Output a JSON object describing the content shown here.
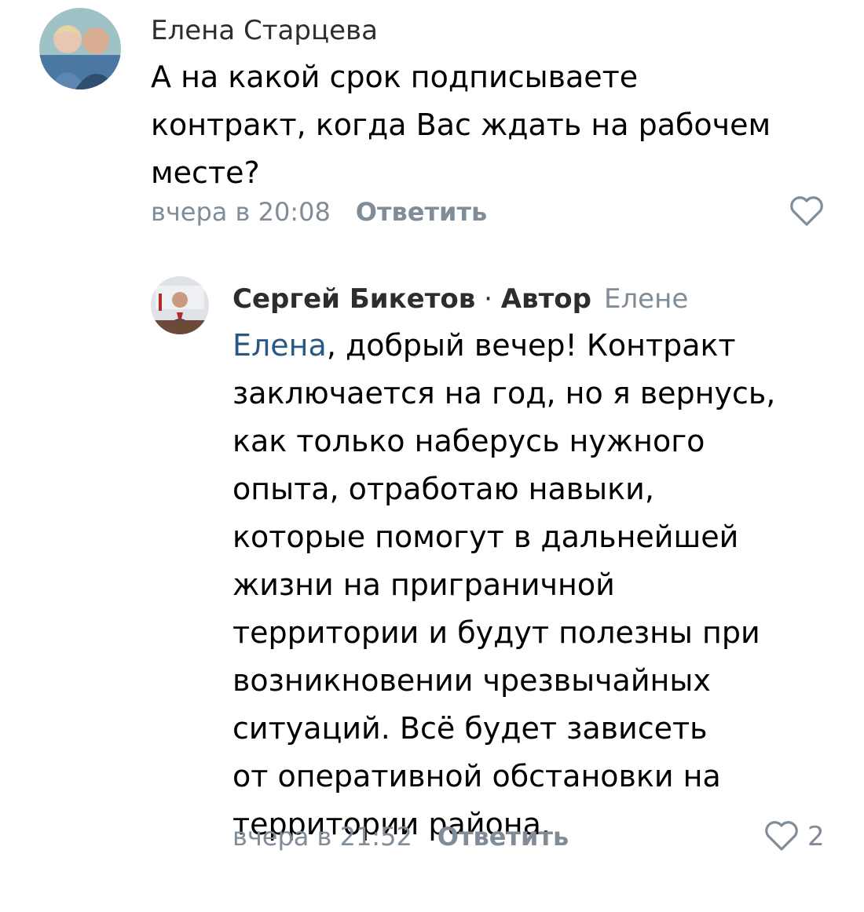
{
  "comments": [
    {
      "author": "Елена Старцева",
      "text": "А на какой срок подписываете\nконтракт, когда Вас ждать на рабочем\nместе?",
      "time": "вчера в 20:08",
      "reply_label": "Ответить",
      "like_count": ""
    },
    {
      "author": "Сергей Бикетов",
      "separator": "·",
      "author_badge": "Автор",
      "reply_to": "Елене",
      "mention": "Елена",
      "text": ", добрый вечер! Контракт\nзаключается на год, но я вернусь,\nкак только наберусь нужного\nопыта, отработаю навыки,\nкоторые помогут в дальнейшей\nжизни на приграничной\nтерритории и будут полезны при\nвозникновении чрезвычайных\nситуаций. Всё  будет зависеть\nот оперативной обстановки на\nтерритории района.",
      "time": "вчера в 21:52",
      "reply_label": "Ответить",
      "like_count": "2"
    }
  ],
  "colors": {
    "text": "#000000",
    "secondary": "#818c99",
    "link": "#2a5885"
  },
  "icons": [
    "heart-outline-icon"
  ]
}
